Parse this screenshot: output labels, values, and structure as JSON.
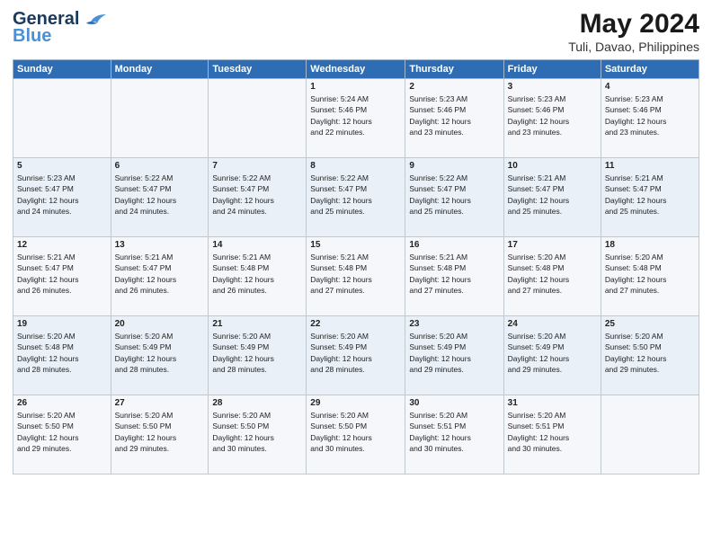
{
  "header": {
    "logo_line1": "General",
    "logo_line2": "Blue",
    "title": "May 2024",
    "subtitle": "Tuli, Davao, Philippines"
  },
  "weekdays": [
    "Sunday",
    "Monday",
    "Tuesday",
    "Wednesday",
    "Thursday",
    "Friday",
    "Saturday"
  ],
  "weeks": [
    [
      {
        "day": "",
        "info": ""
      },
      {
        "day": "",
        "info": ""
      },
      {
        "day": "",
        "info": ""
      },
      {
        "day": "1",
        "info": "Sunrise: 5:24 AM\nSunset: 5:46 PM\nDaylight: 12 hours\nand 22 minutes."
      },
      {
        "day": "2",
        "info": "Sunrise: 5:23 AM\nSunset: 5:46 PM\nDaylight: 12 hours\nand 23 minutes."
      },
      {
        "day": "3",
        "info": "Sunrise: 5:23 AM\nSunset: 5:46 PM\nDaylight: 12 hours\nand 23 minutes."
      },
      {
        "day": "4",
        "info": "Sunrise: 5:23 AM\nSunset: 5:46 PM\nDaylight: 12 hours\nand 23 minutes."
      }
    ],
    [
      {
        "day": "5",
        "info": "Sunrise: 5:23 AM\nSunset: 5:47 PM\nDaylight: 12 hours\nand 24 minutes."
      },
      {
        "day": "6",
        "info": "Sunrise: 5:22 AM\nSunset: 5:47 PM\nDaylight: 12 hours\nand 24 minutes."
      },
      {
        "day": "7",
        "info": "Sunrise: 5:22 AM\nSunset: 5:47 PM\nDaylight: 12 hours\nand 24 minutes."
      },
      {
        "day": "8",
        "info": "Sunrise: 5:22 AM\nSunset: 5:47 PM\nDaylight: 12 hours\nand 25 minutes."
      },
      {
        "day": "9",
        "info": "Sunrise: 5:22 AM\nSunset: 5:47 PM\nDaylight: 12 hours\nand 25 minutes."
      },
      {
        "day": "10",
        "info": "Sunrise: 5:21 AM\nSunset: 5:47 PM\nDaylight: 12 hours\nand 25 minutes."
      },
      {
        "day": "11",
        "info": "Sunrise: 5:21 AM\nSunset: 5:47 PM\nDaylight: 12 hours\nand 25 minutes."
      }
    ],
    [
      {
        "day": "12",
        "info": "Sunrise: 5:21 AM\nSunset: 5:47 PM\nDaylight: 12 hours\nand 26 minutes."
      },
      {
        "day": "13",
        "info": "Sunrise: 5:21 AM\nSunset: 5:47 PM\nDaylight: 12 hours\nand 26 minutes."
      },
      {
        "day": "14",
        "info": "Sunrise: 5:21 AM\nSunset: 5:48 PM\nDaylight: 12 hours\nand 26 minutes."
      },
      {
        "day": "15",
        "info": "Sunrise: 5:21 AM\nSunset: 5:48 PM\nDaylight: 12 hours\nand 27 minutes."
      },
      {
        "day": "16",
        "info": "Sunrise: 5:21 AM\nSunset: 5:48 PM\nDaylight: 12 hours\nand 27 minutes."
      },
      {
        "day": "17",
        "info": "Sunrise: 5:20 AM\nSunset: 5:48 PM\nDaylight: 12 hours\nand 27 minutes."
      },
      {
        "day": "18",
        "info": "Sunrise: 5:20 AM\nSunset: 5:48 PM\nDaylight: 12 hours\nand 27 minutes."
      }
    ],
    [
      {
        "day": "19",
        "info": "Sunrise: 5:20 AM\nSunset: 5:48 PM\nDaylight: 12 hours\nand 28 minutes."
      },
      {
        "day": "20",
        "info": "Sunrise: 5:20 AM\nSunset: 5:49 PM\nDaylight: 12 hours\nand 28 minutes."
      },
      {
        "day": "21",
        "info": "Sunrise: 5:20 AM\nSunset: 5:49 PM\nDaylight: 12 hours\nand 28 minutes."
      },
      {
        "day": "22",
        "info": "Sunrise: 5:20 AM\nSunset: 5:49 PM\nDaylight: 12 hours\nand 28 minutes."
      },
      {
        "day": "23",
        "info": "Sunrise: 5:20 AM\nSunset: 5:49 PM\nDaylight: 12 hours\nand 29 minutes."
      },
      {
        "day": "24",
        "info": "Sunrise: 5:20 AM\nSunset: 5:49 PM\nDaylight: 12 hours\nand 29 minutes."
      },
      {
        "day": "25",
        "info": "Sunrise: 5:20 AM\nSunset: 5:50 PM\nDaylight: 12 hours\nand 29 minutes."
      }
    ],
    [
      {
        "day": "26",
        "info": "Sunrise: 5:20 AM\nSunset: 5:50 PM\nDaylight: 12 hours\nand 29 minutes."
      },
      {
        "day": "27",
        "info": "Sunrise: 5:20 AM\nSunset: 5:50 PM\nDaylight: 12 hours\nand 29 minutes."
      },
      {
        "day": "28",
        "info": "Sunrise: 5:20 AM\nSunset: 5:50 PM\nDaylight: 12 hours\nand 30 minutes."
      },
      {
        "day": "29",
        "info": "Sunrise: 5:20 AM\nSunset: 5:50 PM\nDaylight: 12 hours\nand 30 minutes."
      },
      {
        "day": "30",
        "info": "Sunrise: 5:20 AM\nSunset: 5:51 PM\nDaylight: 12 hours\nand 30 minutes."
      },
      {
        "day": "31",
        "info": "Sunrise: 5:20 AM\nSunset: 5:51 PM\nDaylight: 12 hours\nand 30 minutes."
      },
      {
        "day": "",
        "info": ""
      }
    ]
  ]
}
